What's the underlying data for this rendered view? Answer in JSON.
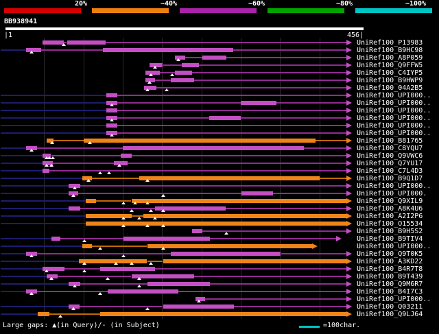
{
  "query": {
    "id": "BB938941",
    "start_label": "|1",
    "end_label": "456|",
    "length": 456
  },
  "legend": {
    "gaps_text": "Large gaps: ▲(in Query)/- (in Subject)",
    "scale_text": "=100char.",
    "scale_color": "#00c3c3"
  },
  "colors": {
    "background": "#000000",
    "purple_thick": "#c44ec4",
    "purple_thin": "#932b93",
    "orange_thick": "#f08418",
    "orange_thin": "#c06a06",
    "lead": "#1d1d70",
    "grid": "#2b2b2b",
    "text": "#ffffff",
    "query_bar": "#ffffff",
    "gap_marker": "#ffffff"
  },
  "chart_data": {
    "type": "bar",
    "variant": "sequence-alignment-span-overview",
    "query_id": "BB938941",
    "x_axis": {
      "min": 1,
      "max": 456,
      "label": "query position"
    },
    "grid_interval": 50,
    "legend_position": "top",
    "identity_key": [
      {
        "label": "20%",
        "color": "#d40000"
      },
      {
        "label": "~40%",
        "color": "#ee7f10"
      },
      {
        "label": "~60%",
        "color": "#aa22aa"
      },
      {
        "label": "~80%",
        "color": "#00a400"
      },
      {
        "label": "~100%",
        "color": "#00c3c3"
      }
    ],
    "segment_format": "[start,end,thick(1|0)] in query coordinates 1..456",
    "rows": [
      {
        "label": "UniRef100_P13983",
        "identity": "purple",
        "lead": false,
        "segments": [
          [
            48,
            75,
            1
          ],
          [
            75,
            79,
            0
          ],
          [
            79,
            128,
            1
          ],
          [
            128,
            434,
            0
          ]
        ],
        "gaps": [
          75
        ],
        "arrow": true
      },
      {
        "label": "UniRef100_B9HC98",
        "identity": "purple",
        "lead": true,
        "segments": [
          [
            27,
            46,
            1
          ],
          [
            46,
            125,
            0
          ],
          [
            125,
            290,
            1
          ],
          [
            290,
            434,
            0
          ]
        ],
        "gaps": [
          34
        ],
        "arrow": true
      },
      {
        "label": "UniRef100_A8P059",
        "identity": "purple",
        "lead": false,
        "segments": [
          [
            216,
            229,
            1
          ],
          [
            229,
            251,
            0
          ],
          [
            251,
            282,
            1
          ],
          [
            282,
            434,
            0
          ]
        ],
        "gaps": [
          221
        ],
        "arrow": true
      },
      {
        "label": "UniRef100_Q9FFW5",
        "identity": "purple",
        "lead": false,
        "segments": [
          [
            184,
            201,
            1
          ],
          [
            201,
            225,
            0
          ],
          [
            225,
            247,
            1
          ],
          [
            247,
            434,
            0
          ]
        ],
        "gaps": [
          191
        ],
        "arrow": true
      },
      {
        "label": "UniRef100_C4IYP5",
        "identity": "purple",
        "lead": false,
        "segments": [
          [
            179,
            197,
            1
          ],
          [
            197,
            216,
            0
          ],
          [
            216,
            238,
            1
          ],
          [
            238,
            434,
            0
          ]
        ],
        "gaps": [
          186,
          213
        ],
        "arrow": true
      },
      {
        "label": "UniRef100_B9HWP9",
        "identity": "purple",
        "lead": false,
        "segments": [
          [
            179,
            191,
            1
          ],
          [
            191,
            211,
            0
          ],
          [
            211,
            241,
            1
          ],
          [
            241,
            434,
            0
          ]
        ],
        "gaps": [
          184
        ],
        "arrow": true
      },
      {
        "label": "UniRef100_04A2B5",
        "identity": "purple",
        "lead": false,
        "segments": [
          [
            177,
            193,
            1
          ],
          [
            193,
            434,
            0
          ]
        ],
        "gaps": [
          181,
          206
        ],
        "arrow": true
      },
      {
        "label": "UniRef100_UPI000..",
        "identity": "purple",
        "lead": true,
        "segments": [
          [
            129,
            143,
            1
          ],
          [
            143,
            434,
            0
          ]
        ],
        "gaps": [],
        "arrow": true
      },
      {
        "label": "UniRef100_UPI000..",
        "identity": "purple",
        "lead": true,
        "segments": [
          [
            129,
            143,
            1
          ],
          [
            143,
            300,
            0
          ],
          [
            300,
            345,
            1
          ],
          [
            345,
            434,
            0
          ]
        ],
        "gaps": [
          136
        ],
        "arrow": true
      },
      {
        "label": "UniRef100_UPI000..",
        "identity": "purple",
        "lead": true,
        "segments": [
          [
            129,
            143,
            1
          ],
          [
            143,
            434,
            0
          ]
        ],
        "gaps": [],
        "arrow": true
      },
      {
        "label": "UniRef100_UPI000..",
        "identity": "purple",
        "lead": true,
        "segments": [
          [
            129,
            143,
            1
          ],
          [
            143,
            260,
            0
          ],
          [
            260,
            300,
            1
          ],
          [
            300,
            434,
            0
          ]
        ],
        "gaps": [
          136
        ],
        "arrow": true
      },
      {
        "label": "UniRef100_UPI000..",
        "identity": "purple",
        "lead": true,
        "segments": [
          [
            129,
            143,
            1
          ],
          [
            143,
            434,
            0
          ]
        ],
        "gaps": [],
        "arrow": true
      },
      {
        "label": "UniRef100_UPI000..",
        "identity": "purple",
        "lead": true,
        "segments": [
          [
            129,
            143,
            1
          ],
          [
            143,
            434,
            0
          ]
        ],
        "gaps": [
          136
        ],
        "arrow": true
      },
      {
        "label": "UniRef100_B81765",
        "identity": "orange",
        "lead": false,
        "segments": [
          [
            53,
            62,
            1
          ],
          [
            62,
            100,
            0
          ],
          [
            100,
            395,
            1
          ],
          [
            395,
            434,
            0
          ]
        ],
        "gaps": [
          60,
          108
        ],
        "arrow": true
      },
      {
        "label": "UniRef100_C8YQU7",
        "identity": "purple",
        "lead": true,
        "segments": [
          [
            27,
            41,
            1
          ],
          [
            41,
            150,
            0
          ],
          [
            150,
            380,
            1
          ],
          [
            380,
            434,
            0
          ]
        ],
        "gaps": [
          34
        ],
        "arrow": true
      },
      {
        "label": "UniRef100_Q9VWC6",
        "identity": "purple",
        "lead": true,
        "segments": [
          [
            48,
            59,
            1
          ],
          [
            59,
            147,
            0
          ],
          [
            147,
            161,
            1
          ],
          [
            161,
            434,
            0
          ]
        ],
        "gaps": [
          53,
          57,
          61
        ],
        "arrow": true
      },
      {
        "label": "UniRef100_Q7YU17",
        "identity": "purple",
        "lead": true,
        "segments": [
          [
            48,
            61,
            1
          ],
          [
            61,
            139,
            0
          ],
          [
            139,
            156,
            1
          ],
          [
            156,
            434,
            0
          ]
        ],
        "gaps": [
          53,
          59,
          146
        ],
        "arrow": true
      },
      {
        "label": "UniRef100_C7L4D3",
        "identity": "purple",
        "lead": true,
        "segments": [
          [
            48,
            57,
            1
          ],
          [
            57,
            434,
            0
          ]
        ],
        "gaps": [
          121,
          133
        ],
        "arrow": true
      },
      {
        "label": "UniRef100_B9Q1D7",
        "identity": "orange",
        "lead": true,
        "segments": [
          [
            99,
            111,
            1
          ],
          [
            111,
            171,
            0
          ],
          [
            171,
            400,
            1
          ],
          [
            400,
            434,
            0
          ]
        ],
        "gaps": [
          106,
          181
        ],
        "arrow": true
      },
      {
        "label": "UniRef100_UPI000..",
        "identity": "purple",
        "lead": true,
        "segments": [
          [
            81,
            96,
            1
          ],
          [
            96,
            434,
            0
          ]
        ],
        "gaps": [
          89
        ],
        "arrow": true
      },
      {
        "label": "UniRef100_UPI000.",
        "identity": "purple",
        "lead": true,
        "segments": [
          [
            81,
            93,
            1
          ],
          [
            93,
            301,
            0
          ],
          [
            301,
            341,
            1
          ],
          [
            341,
            434,
            0
          ]
        ],
        "gaps": [
          87,
          201
        ],
        "arrow": true
      },
      {
        "label": "UniRef100_Q9XIL9",
        "identity": "orange",
        "lead": true,
        "segments": [
          [
            103,
            116,
            1
          ],
          [
            116,
            161,
            0
          ],
          [
            161,
            434,
            1
          ]
        ],
        "gaps": [
          151,
          166,
          181
        ],
        "arrow": true
      },
      {
        "label": "UniRef100_A8K4U6",
        "identity": "purple",
        "lead": true,
        "segments": [
          [
            81,
            96,
            1
          ],
          [
            96,
            191,
            0
          ],
          [
            191,
            281,
            1
          ],
          [
            281,
            434,
            0
          ]
        ],
        "gaps": [
          161,
          186,
          201
        ],
        "arrow": true
      },
      {
        "label": "UniRef100_A2I2P6",
        "identity": "orange",
        "lead": true,
        "segments": [
          [
            103,
            161,
            1
          ],
          [
            161,
            176,
            0
          ],
          [
            176,
            434,
            1
          ]
        ],
        "gaps": [
          151,
          171,
          191
        ],
        "arrow": true
      },
      {
        "label": "UniRef100_O15534",
        "identity": "orange",
        "lead": true,
        "segments": [
          [
            103,
            434,
            1
          ]
        ],
        "gaps": [
          151,
          181,
          201
        ],
        "arrow": true
      },
      {
        "label": "UniRef100_B9H5S2",
        "identity": "purple",
        "lead": false,
        "segments": [
          [
            238,
            251,
            1
          ],
          [
            251,
            434,
            0
          ]
        ],
        "gaps": [
          282
        ],
        "arrow": true
      },
      {
        "label": "UniRef100_B9TIV4",
        "identity": "purple",
        "lead": true,
        "segments": [
          [
            59,
            71,
            1
          ],
          [
            71,
            151,
            0
          ],
          [
            151,
            261,
            1
          ],
          [
            261,
            421,
            0
          ]
        ],
        "gaps": [
          101
        ],
        "arrow": true
      },
      {
        "label": "UniRef100_UPI000..",
        "identity": "orange",
        "lead": true,
        "segments": [
          [
            99,
            111,
            1
          ],
          [
            111,
            181,
            0
          ],
          [
            181,
            391,
            1
          ]
        ],
        "gaps": [
          121,
          201
        ],
        "arrow": true
      },
      {
        "label": "UniRef100_Q9T0K5",
        "identity": "purple",
        "lead": true,
        "segments": [
          [
            27,
            41,
            1
          ],
          [
            41,
            211,
            0
          ],
          [
            211,
            351,
            1
          ],
          [
            351,
            434,
            0
          ]
        ],
        "gaps": [
          34,
          151
        ],
        "arrow": true
      },
      {
        "label": "UniRef100_A3KD22",
        "identity": "orange",
        "lead": true,
        "segments": [
          [
            94,
            181,
            1
          ],
          [
            181,
            201,
            0
          ],
          [
            201,
            434,
            1
          ]
        ],
        "gaps": [
          101,
          141,
          161,
          186
        ],
        "arrow": true
      },
      {
        "label": "UniRef100_B4R7T8",
        "identity": "purple",
        "lead": true,
        "segments": [
          [
            48,
            76,
            1
          ],
          [
            76,
            121,
            0
          ],
          [
            121,
            191,
            1
          ],
          [
            191,
            434,
            0
          ]
        ],
        "gaps": [
          53,
          101
        ],
        "arrow": true
      },
      {
        "label": "UniRef100_B9T439",
        "identity": "purple",
        "lead": true,
        "segments": [
          [
            53,
            67,
            1
          ],
          [
            67,
            161,
            0
          ],
          [
            161,
            241,
            1
          ],
          [
            241,
            434,
            0
          ]
        ],
        "gaps": [
          59,
          131,
          171
        ],
        "arrow": true
      },
      {
        "label": "UniRef100_Q9M6R7",
        "identity": "purple",
        "lead": true,
        "segments": [
          [
            81,
            96,
            1
          ],
          [
            96,
            181,
            0
          ],
          [
            181,
            261,
            1
          ],
          [
            261,
            434,
            0
          ]
        ],
        "gaps": [
          89,
          171
        ],
        "arrow": true
      },
      {
        "label": "UniRef100_B4I7C3",
        "identity": "purple",
        "lead": true,
        "segments": [
          [
            27,
            41,
            1
          ],
          [
            41,
            131,
            0
          ],
          [
            131,
            221,
            1
          ],
          [
            221,
            434,
            0
          ]
        ],
        "gaps": [
          34,
          121
        ],
        "arrow": true
      },
      {
        "label": "UniRef100_UPI000..",
        "identity": "purple",
        "lead": false,
        "segments": [
          [
            242,
            255,
            1
          ],
          [
            255,
            434,
            0
          ]
        ],
        "gaps": [
          247
        ],
        "arrow": true
      },
      {
        "label": "UniRef100_Q03211",
        "identity": "purple",
        "lead": true,
        "segments": [
          [
            81,
            95,
            1
          ],
          [
            95,
            201,
            0
          ],
          [
            201,
            291,
            1
          ],
          [
            291,
            434,
            0
          ]
        ],
        "gaps": [
          87,
          181
        ],
        "arrow": true
      },
      {
        "label": "UniRef100_Q9LJ64",
        "identity": "orange",
        "lead": true,
        "segments": [
          [
            42,
            57,
            1
          ],
          [
            57,
            121,
            0
          ],
          [
            121,
            434,
            1
          ]
        ],
        "gaps": [
          71
        ],
        "arrow": true
      }
    ]
  }
}
